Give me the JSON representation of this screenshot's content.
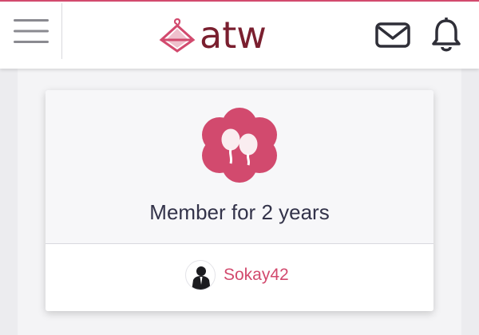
{
  "header": {
    "logo_text": "atw",
    "icons": {
      "menu": "hamburger-menu-icon",
      "logo": "hanger-icon",
      "mail": "envelope-icon",
      "bell": "bell-icon"
    }
  },
  "card": {
    "badge_icon": "balloons-icon",
    "title": "Member for 2 years",
    "user": {
      "name": "Sokay42",
      "avatar": "user-avatar-icon"
    }
  },
  "colors": {
    "accent": "#d24a6e",
    "logo_text": "#7a1f2f",
    "title_text": "#33334a",
    "background": "#ececef"
  }
}
